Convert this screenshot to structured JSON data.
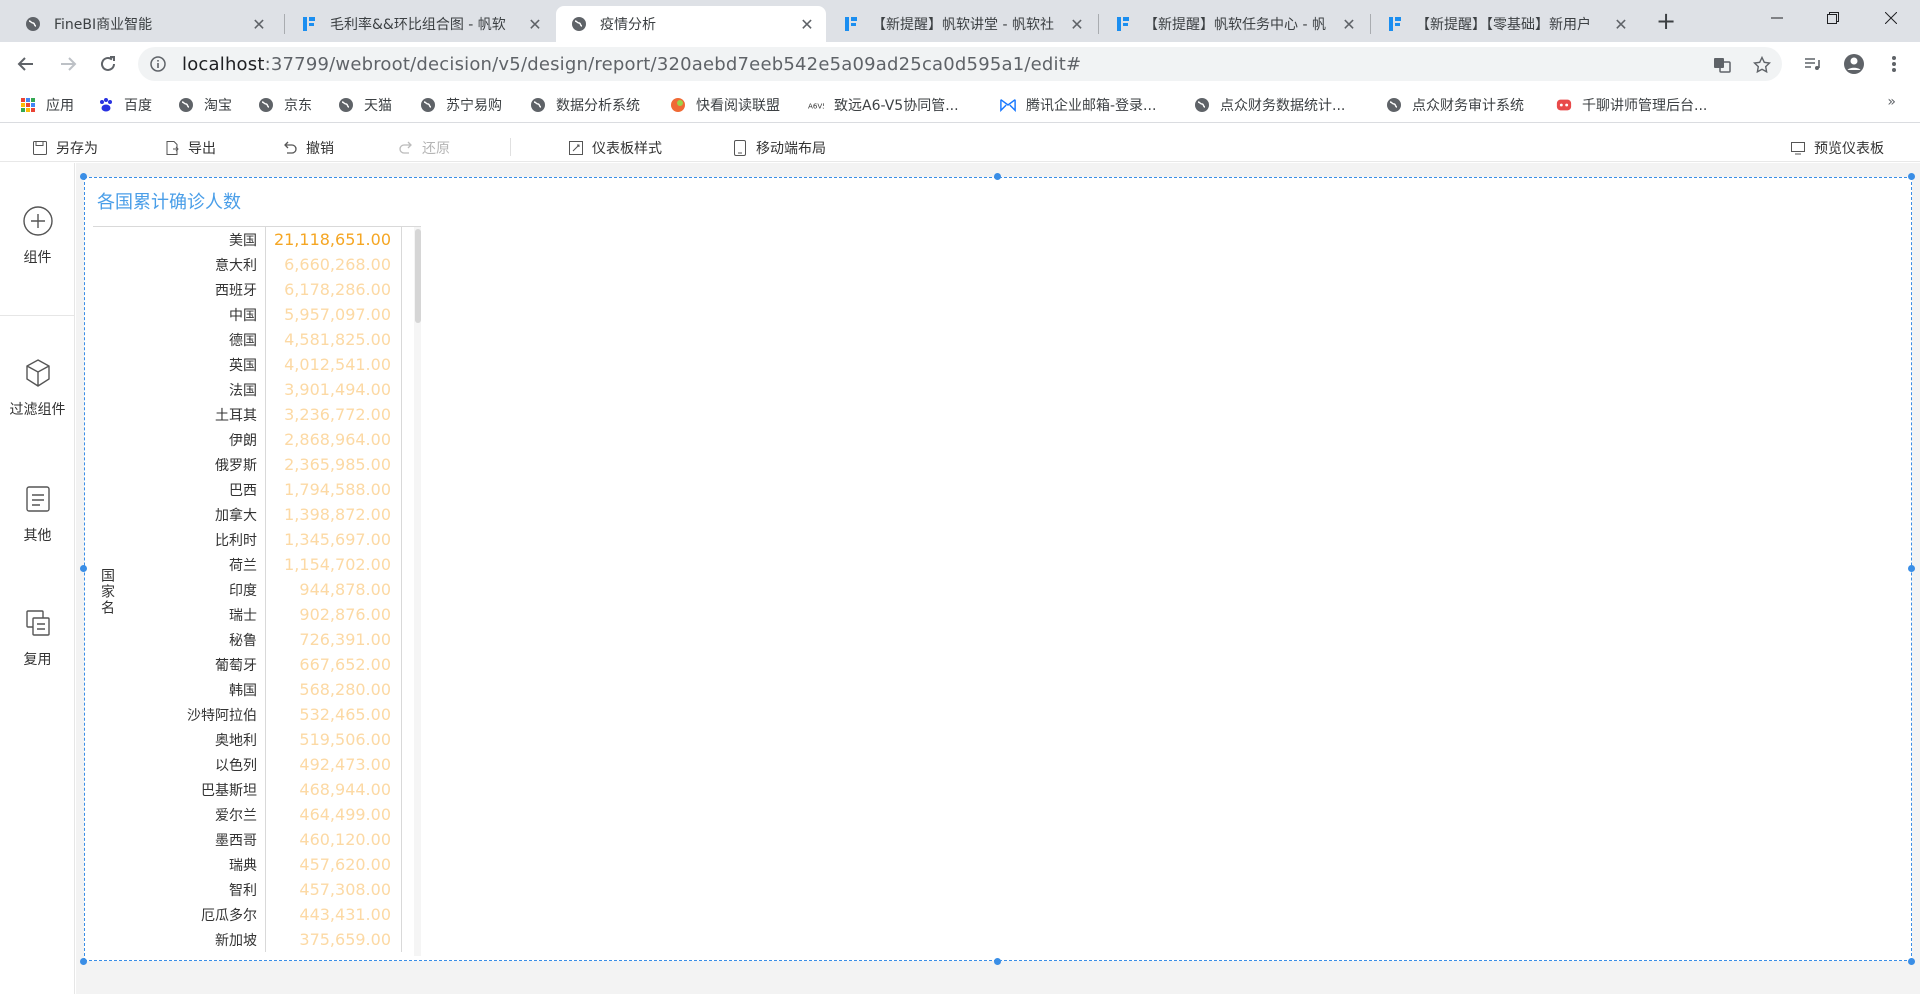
{
  "browser": {
    "tabs": [
      {
        "title": "FineBI商业智能",
        "active": false
      },
      {
        "title": "毛利率&&环比组合图 - 帆软",
        "active": false
      },
      {
        "title": "疫情分析",
        "active": true
      },
      {
        "title": "【新提醒】帆软讲堂 - 帆软社",
        "active": false
      },
      {
        "title": "【新提醒】帆软任务中心 - 帆",
        "active": false
      },
      {
        "title": "【新提醒】【零基础】新用户",
        "active": false
      }
    ],
    "new_tab": "+",
    "url_host": "localhost",
    "url_rest": ":37799/webroot/decision/v5/design/report/320aebd7eeb542e5a09ad25ca0d595a1/edit#",
    "bookmarks": [
      "应用",
      "百度",
      "淘宝",
      "京东",
      "天猫",
      "苏宁易购",
      "数据分析系统",
      "快看阅读联盟",
      "致远A6-V5协同管...",
      "腾讯企业邮箱-登录...",
      "点众财务数据统计...",
      "点众财务审计系统",
      "千聊讲师管理后台..."
    ],
    "bookmarks_more": "»"
  },
  "toolbar": {
    "save_as": "另存为",
    "export": "导出",
    "undo": "撤销",
    "redo": "还原",
    "dashboard_style": "仪表板样式",
    "mobile_layout": "移动端布局",
    "preview": "预览仪表板"
  },
  "left_panel": {
    "items": [
      "组件",
      "过滤组件",
      "其他",
      "复用"
    ]
  },
  "widget": {
    "title": "各国累计确诊人数",
    "dimension_label": "国家名",
    "rows": [
      {
        "country": "美国",
        "value": "21,118,651.00"
      },
      {
        "country": "意大利",
        "value": "6,660,268.00"
      },
      {
        "country": "西班牙",
        "value": "6,178,286.00"
      },
      {
        "country": "中国",
        "value": "5,957,097.00"
      },
      {
        "country": "德国",
        "value": "4,581,825.00"
      },
      {
        "country": "英国",
        "value": "4,012,541.00"
      },
      {
        "country": "法国",
        "value": "3,901,494.00"
      },
      {
        "country": "土耳其",
        "value": "3,236,772.00"
      },
      {
        "country": "伊朗",
        "value": "2,868,964.00"
      },
      {
        "country": "俄罗斯",
        "value": "2,365,985.00"
      },
      {
        "country": "巴西",
        "value": "1,794,588.00"
      },
      {
        "country": "加拿大",
        "value": "1,398,872.00"
      },
      {
        "country": "比利时",
        "value": "1,345,697.00"
      },
      {
        "country": "荷兰",
        "value": "1,154,702.00"
      },
      {
        "country": "印度",
        "value": "944,878.00"
      },
      {
        "country": "瑞士",
        "value": "902,876.00"
      },
      {
        "country": "秘鲁",
        "value": "726,391.00"
      },
      {
        "country": "葡萄牙",
        "value": "667,652.00"
      },
      {
        "country": "韩国",
        "value": "568,280.00"
      },
      {
        "country": "沙特阿拉伯",
        "value": "532,465.00"
      },
      {
        "country": "奥地利",
        "value": "519,506.00"
      },
      {
        "country": "以色列",
        "value": "492,473.00"
      },
      {
        "country": "巴基斯坦",
        "value": "468,944.00"
      },
      {
        "country": "爱尔兰",
        "value": "464,499.00"
      },
      {
        "country": "墨西哥",
        "value": "460,120.00"
      },
      {
        "country": "瑞典",
        "value": "457,620.00"
      },
      {
        "country": "智利",
        "value": "457,308.00"
      },
      {
        "country": "厄瓜多尔",
        "value": "443,431.00"
      },
      {
        "country": "新加坡",
        "value": "375,659.00"
      }
    ]
  },
  "colors": {
    "value_strong": "#f5a623",
    "value_light": "#fcd9a4",
    "accent": "#3a8ee6"
  }
}
